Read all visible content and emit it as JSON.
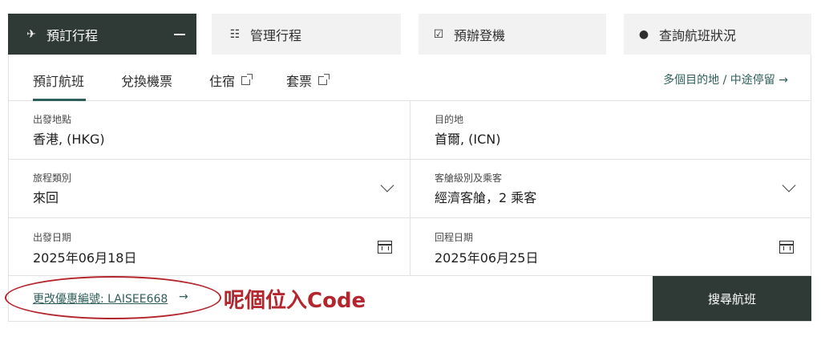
{
  "top_tabs": [
    {
      "label": "預訂行程",
      "icon": "plane-icon"
    },
    {
      "label": "管理行程",
      "icon": "list-icon"
    },
    {
      "label": "預辦登機",
      "icon": "checkin-icon"
    },
    {
      "label": "查詢航班狀況",
      "icon": "clock-icon"
    }
  ],
  "sub_tabs": [
    {
      "label": "預訂航班"
    },
    {
      "label": "兌換機票"
    },
    {
      "label": "住宿"
    },
    {
      "label": "套票"
    }
  ],
  "multi_city_link": "多個目的地 / 中途停留 →",
  "fields": {
    "origin": {
      "label": "出發地點",
      "value": "香港, (HKG)"
    },
    "destination": {
      "label": "目的地",
      "value": "首爾, (ICN)"
    },
    "trip_type": {
      "label": "旅程類別",
      "value": "來回"
    },
    "cabin": {
      "label": "客艙級別及乘客",
      "value": "經濟客艙，2 乘客"
    },
    "depart_date": {
      "label": "出發日期",
      "value": "2025年06月18日"
    },
    "return_date": {
      "label": "回程日期",
      "value": "2025年06月25日"
    }
  },
  "promo_link": "更改優惠編號: LAISEE668",
  "promo_arrow": "→",
  "annotation": "呢個位入Code",
  "search_button": "搜尋航班",
  "colors": {
    "dark": "#2f3a36",
    "accent": "#2f5f5a",
    "annotation": "#b3262d"
  }
}
